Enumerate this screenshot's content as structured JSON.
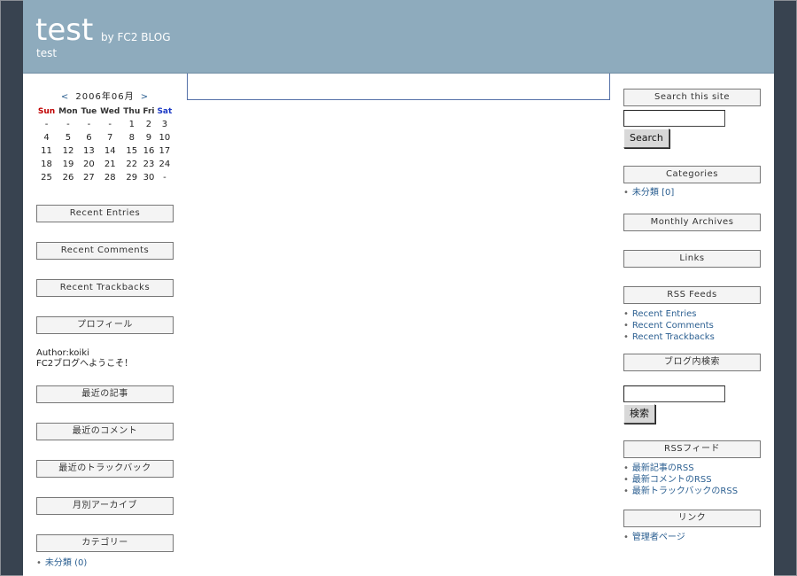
{
  "header": {
    "title": "test",
    "by": "by FC2 BLOG",
    "description": "test"
  },
  "calendar": {
    "prev": "<",
    "month": "2006年06月",
    "next": ">",
    "weekdays": [
      "Sun",
      "Mon",
      "Tue",
      "Wed",
      "Thu",
      "Fri",
      "Sat"
    ],
    "weeks": [
      [
        "-",
        "-",
        "-",
        "-",
        "1",
        "2",
        "3"
      ],
      [
        "4",
        "5",
        "6",
        "7",
        "8",
        "9",
        "10"
      ],
      [
        "11",
        "12",
        "13",
        "14",
        "15",
        "16",
        "17"
      ],
      [
        "18",
        "19",
        "20",
        "21",
        "22",
        "23",
        "24"
      ],
      [
        "25",
        "26",
        "27",
        "28",
        "29",
        "30",
        "-"
      ]
    ]
  },
  "left": {
    "recent_entries": "Recent Entries",
    "recent_comments": "Recent Comments",
    "recent_trackbacks": "Recent Trackbacks",
    "profile_title": "プロフィール",
    "author": "Author:koiki",
    "welcome": "FC2ブログへようこそ！",
    "latest_posts": "最近の記事",
    "latest_comments": "最近のコメント",
    "latest_trackbacks": "最近のトラックバック",
    "monthly_archive": "月別アーカイブ",
    "category_title": "カテゴリー",
    "category_item": "未分類 (0)"
  },
  "right": {
    "search_title": "Search this site",
    "search_button": "Search",
    "categories_title": "Categories",
    "category_item": "未分類 [0]",
    "monthly_archives": "Monthly Archives",
    "links": "Links",
    "rss_title": "RSS Feeds",
    "rss_items": [
      "Recent Entries",
      "Recent Comments",
      "Recent Trackbacks"
    ],
    "blog_search_title": "ブログ内検索",
    "blog_search_button": "検索",
    "rss_jp_title": "RSSフィード",
    "rss_jp_items": [
      "最新記事のRSS",
      "最新コメントのRSS",
      "最新トラックバックのRSS"
    ],
    "link_jp_title": "リンク",
    "link_jp_item": "管理者ページ"
  }
}
